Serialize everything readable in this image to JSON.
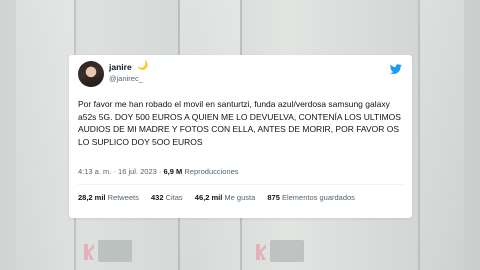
{
  "tweet": {
    "name": "janire",
    "name_emoji": "🌙",
    "handle": "@janirec_",
    "text": "Por favor me han robado el movil en santurtzi, funda azul/verdosa samsung galaxy a52s 5G. DOY 500 EUROS A QUIEN ME LO DEVUELVA, CONTENÍA LOS ULTIMOS AUDIOS DE MI MADRE Y FOTOS CON ELLA, ANTES DE MORIR, POR FAVOR OS LO SUPLICO DOY 5OO EUROS",
    "time": "4:13 a. m.",
    "separator": " · ",
    "date": "16 jul. 2023",
    "views_count": "6,9 M",
    "views_label": "Reproducciones",
    "stats": {
      "retweets_count": "28,2 mil",
      "retweets_label": "Retweets",
      "quotes_count": "432",
      "quotes_label": "Citas",
      "likes_count": "46,2 mil",
      "likes_label": "Me gusta",
      "bookmarks_count": "875",
      "bookmarks_label": "Elementos guardados"
    }
  },
  "colors": {
    "twitter_blue": "#1d9bf0",
    "text_primary": "#0f1419",
    "text_secondary": "#536471"
  },
  "icons": {
    "logo": "twitter-bird-icon",
    "avatar": "profile-photo"
  }
}
